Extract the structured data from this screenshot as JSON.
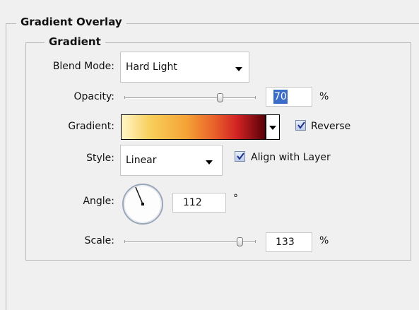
{
  "panel": {
    "title": "Gradient Overlay",
    "section_title": "Gradient"
  },
  "blend_mode": {
    "label": "Blend Mode:",
    "value": "Hard Light"
  },
  "opacity": {
    "label": "Opacity:",
    "value": "70",
    "unit": "%",
    "level": 0.7
  },
  "gradient": {
    "label": "Gradient:",
    "colors": [
      "#fff6c8",
      "#f5b23a",
      "#e8602a",
      "#d42424",
      "#5a0008"
    ],
    "reverse_label": "Reverse",
    "reverse_checked": true
  },
  "style": {
    "label": "Style:",
    "value": "Linear",
    "align_label": "Align with Layer",
    "align_checked": true
  },
  "angle": {
    "label": "Angle:",
    "value": "112",
    "unit": "°"
  },
  "scale": {
    "label": "Scale:",
    "value": "133",
    "unit": "%"
  }
}
